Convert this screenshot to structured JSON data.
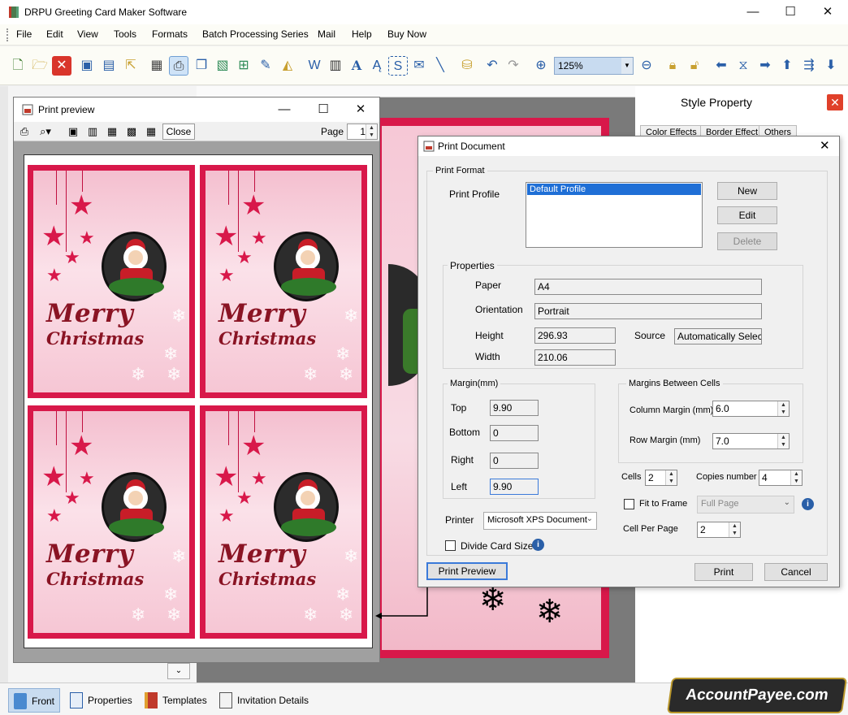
{
  "app": {
    "title": "DRPU Greeting Card Maker Software",
    "menu": [
      "File",
      "Edit",
      "View",
      "Tools",
      "Formats",
      "Batch Processing Series",
      "Mail",
      "Help",
      "Buy Now"
    ],
    "zoom": "125%"
  },
  "style_property": {
    "title": "Style Property",
    "tabs": [
      "Color Effects",
      "Border Effect",
      "Others"
    ]
  },
  "bottom_tabs": [
    "Front",
    "Properties",
    "Templates",
    "Invitation Details"
  ],
  "brand": "AccountPayee.com",
  "print_preview": {
    "title": "Print preview",
    "close_label": "Close",
    "page_label": "Page",
    "page_value": "1",
    "card_line1": "Merry",
    "card_line2": "Christmas"
  },
  "print_document": {
    "title": "Print Document",
    "print_format_label": "Print Format",
    "print_profile_label": "Print Profile",
    "profiles": [
      "Default Profile"
    ],
    "new_label": "New",
    "edit_label": "Edit",
    "delete_label": "Delete",
    "properties_label": "Properties",
    "paper_label": "Paper",
    "paper_value": "A4",
    "orientation_label": "Orientation",
    "orientation_value": "Portrait",
    "height_label": "Height",
    "height_value": "296.93",
    "width_label": "Width",
    "width_value": "210.06",
    "source_label": "Source",
    "source_value": "Automatically Select",
    "margin_label": "Margin(mm)",
    "top_label": "Top",
    "top_value": "9.90",
    "bottom_label": "Bottom",
    "bottom_value": "0",
    "right_label": "Right",
    "right_value": "0",
    "left_label": "Left",
    "left_value": "9.90",
    "margins_between_label": "Margins Between Cells",
    "column_margin_label": "Column Margin (mm)",
    "column_margin_value": "6.0",
    "row_margin_label": "Row Margin (mm)",
    "row_margin_value": "7.0",
    "cells_label": "Cells",
    "cells_value": "2",
    "copies_label": "Copies number",
    "copies_value": "4",
    "fit_to_frame_label": "Fit to Frame",
    "fit_to_frame_value": "Full Page",
    "cell_per_page_label": "Cell Per Page",
    "cell_per_page_value": "2",
    "printer_label": "Printer",
    "printer_value": "Microsoft XPS Document",
    "divide_card_label": "Divide Card Size",
    "print_preview_label": "Print Preview",
    "print_label": "Print",
    "cancel_label": "Cancel"
  },
  "colors": {
    "card_red": "#d8184a",
    "card_text": "#8a1424",
    "accent_blue": "#3b7ad9"
  }
}
